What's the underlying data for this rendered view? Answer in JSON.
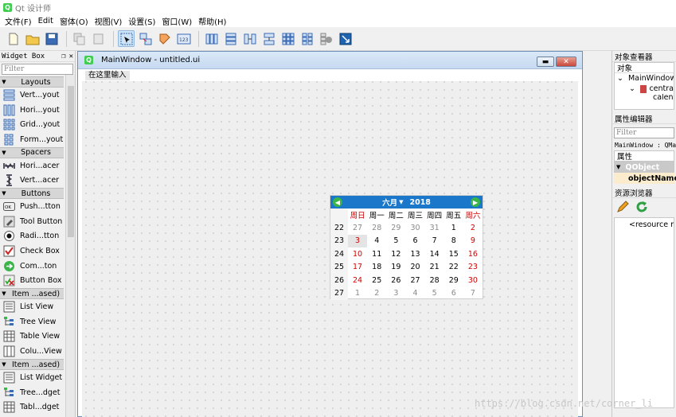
{
  "app": {
    "title": "Qt 设计师"
  },
  "menubar": [
    "文件(F)",
    "Edit",
    "窗体(O)",
    "视图(V)",
    "设置(S)",
    "窗口(W)",
    "帮助(H)"
  ],
  "widget_box": {
    "title": "Widget Box",
    "filter_placeholder": "Filter",
    "categories": [
      {
        "label": "Layouts",
        "items": [
          {
            "label": "Vert...yout",
            "icon": "vertical-layout-icon"
          },
          {
            "label": "Hori...yout",
            "icon": "horizontal-layout-icon"
          },
          {
            "label": "Grid...yout",
            "icon": "grid-layout-icon"
          },
          {
            "label": "Form...yout",
            "icon": "form-layout-icon"
          }
        ]
      },
      {
        "label": "Spacers",
        "items": [
          {
            "label": "Hori...acer",
            "icon": "horizontal-spacer-icon"
          },
          {
            "label": "Vert...acer",
            "icon": "vertical-spacer-icon"
          }
        ]
      },
      {
        "label": "Buttons",
        "items": [
          {
            "label": "Push...tton",
            "icon": "push-button-icon"
          },
          {
            "label": "Tool Button",
            "icon": "tool-button-icon"
          },
          {
            "label": "Radi...tton",
            "icon": "radio-button-icon"
          },
          {
            "label": "Check Box",
            "icon": "check-box-icon"
          },
          {
            "label": "Com...ton",
            "icon": "command-link-icon"
          },
          {
            "label": "Button Box",
            "icon": "button-box-icon"
          }
        ]
      },
      {
        "label": "Item ...ased)",
        "items": [
          {
            "label": "List View",
            "icon": "list-view-icon"
          },
          {
            "label": "Tree View",
            "icon": "tree-view-icon"
          },
          {
            "label": "Table View",
            "icon": "table-view-icon"
          },
          {
            "label": "Colu...View",
            "icon": "column-view-icon"
          }
        ]
      },
      {
        "label": "Item ...ased)",
        "items": [
          {
            "label": "List Widget",
            "icon": "list-widget-icon"
          },
          {
            "label": "Tree...dget",
            "icon": "tree-widget-icon"
          },
          {
            "label": "Tabl...dget",
            "icon": "table-widget-icon"
          }
        ]
      }
    ]
  },
  "mdi": {
    "title": "MainWindow - untitled.ui",
    "form_menu_placeholder": "在这里输入"
  },
  "calendar": {
    "month": "六月",
    "year": "2018",
    "weekday_headers": [
      "周日",
      "周一",
      "周二",
      "周三",
      "周四",
      "周五",
      "周六"
    ],
    "weeks": [
      {
        "week": "22",
        "days": [
          "27",
          "28",
          "29",
          "30",
          "31",
          "1",
          "2"
        ]
      },
      {
        "week": "23",
        "days": [
          "3",
          "4",
          "5",
          "6",
          "7",
          "8",
          "9"
        ]
      },
      {
        "week": "24",
        "days": [
          "10",
          "11",
          "12",
          "13",
          "14",
          "15",
          "16"
        ]
      },
      {
        "week": "25",
        "days": [
          "17",
          "18",
          "19",
          "20",
          "21",
          "22",
          "23"
        ]
      },
      {
        "week": "26",
        "days": [
          "24",
          "25",
          "26",
          "27",
          "28",
          "29",
          "30"
        ]
      },
      {
        "week": "27",
        "days": [
          "1",
          "2",
          "3",
          "4",
          "5",
          "6",
          "7"
        ]
      }
    ],
    "selected_day": "3",
    "accent": "#1a77c9",
    "weekend_color": "#d20000"
  },
  "object_inspector": {
    "title": "对象查看器",
    "column": "对象",
    "rows": [
      "MainWindow",
      "centra",
      "calend"
    ]
  },
  "property_editor": {
    "title": "属性编辑器",
    "filter_placeholder": "Filter",
    "context": "MainWindow : QMai",
    "column": "属性",
    "group": "QObject",
    "property": "objectName"
  },
  "resource_browser": {
    "title": "资源浏览器",
    "root": "<resource ro"
  },
  "watermark": "https://blog.csdn.net/corner_li"
}
